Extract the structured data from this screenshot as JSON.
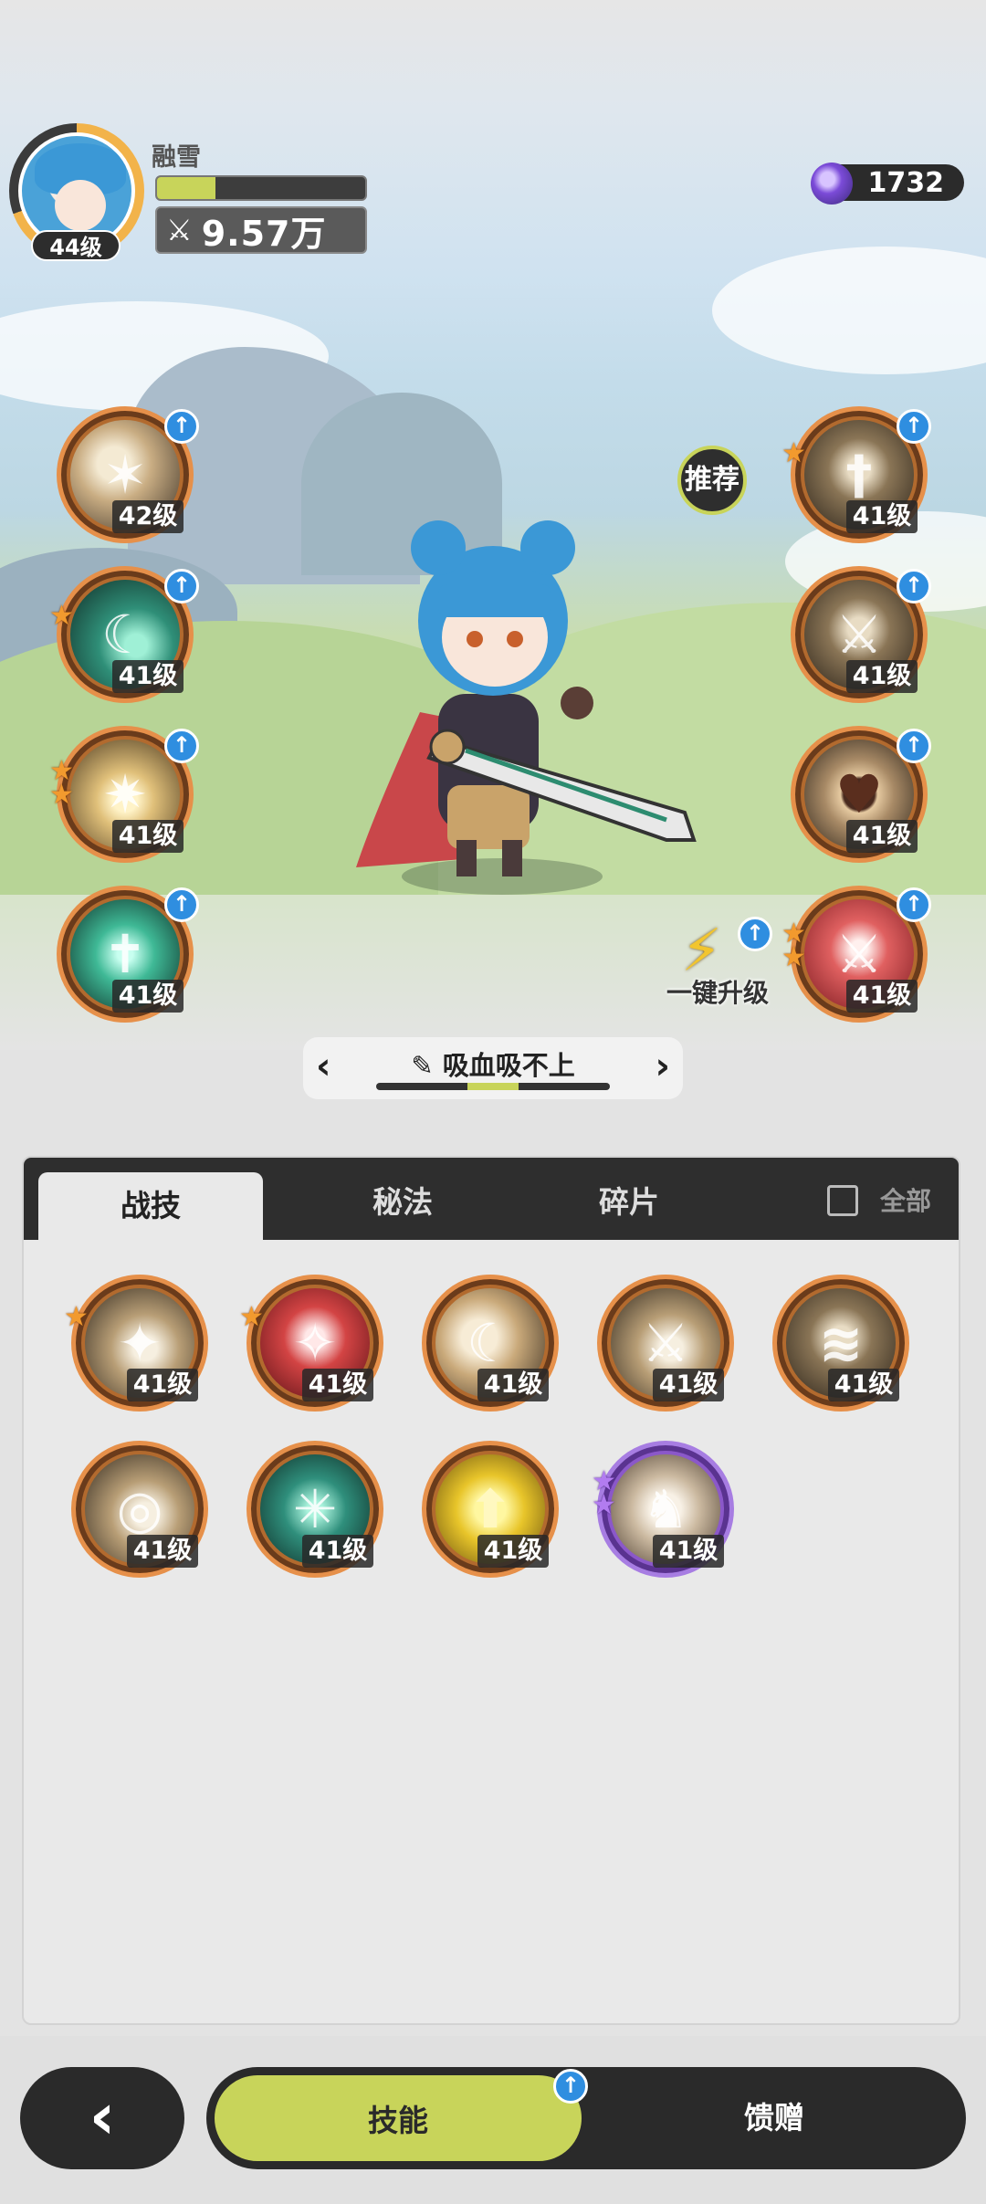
{
  "player": {
    "name": "融雪",
    "level": "44级",
    "power": "9.57万",
    "xp_fraction": 0.28
  },
  "currency": {
    "amount": "1732",
    "icon": "purple-gem-icon"
  },
  "recommend_label": "推荐",
  "left_skills": [
    {
      "level": "42级",
      "stars": 0,
      "upgradable": true
    },
    {
      "level": "41级",
      "stars": 1,
      "upgradable": true
    },
    {
      "level": "41级",
      "stars": 2,
      "upgradable": true
    },
    {
      "level": "41级",
      "stars": 0,
      "upgradable": true
    }
  ],
  "right_skills": [
    {
      "level": "41级",
      "stars": 1,
      "upgradable": true
    },
    {
      "level": "41级",
      "stars": 0,
      "upgradable": true
    },
    {
      "level": "41级",
      "stars": 0,
      "upgradable": true
    },
    {
      "level": "41级",
      "stars": 2,
      "upgradable": true
    }
  ],
  "one_click_upgrade": "一键升级",
  "preset": {
    "name": "吸血吸不上",
    "prev_icon": "chevron-left-icon",
    "next_icon": "chevron-right-icon"
  },
  "tabs": [
    "战技",
    "秘法",
    "碎片"
  ],
  "all_label": "全部",
  "owned_skills": [
    {
      "level": "41级",
      "stars": 1
    },
    {
      "level": "41级",
      "stars": 1
    },
    {
      "level": "41级",
      "stars": 0
    },
    {
      "level": "41级",
      "stars": 0
    },
    {
      "level": "41级",
      "stars": 0
    },
    {
      "level": "41级",
      "stars": 0
    },
    {
      "level": "41级",
      "stars": 0
    },
    {
      "level": "41级",
      "stars": 0
    },
    {
      "level": "41级",
      "stars": 2,
      "rarity": "purple"
    }
  ],
  "bottom_nav": {
    "back_icon": "back-arrow-icon",
    "skills": "技能",
    "gift": "馈赠"
  },
  "colors": {
    "accent": "#c8d45a",
    "dark": "#2a2a2a",
    "upgrade_badge": "#2f8ee0",
    "star": "#f29a2e"
  }
}
